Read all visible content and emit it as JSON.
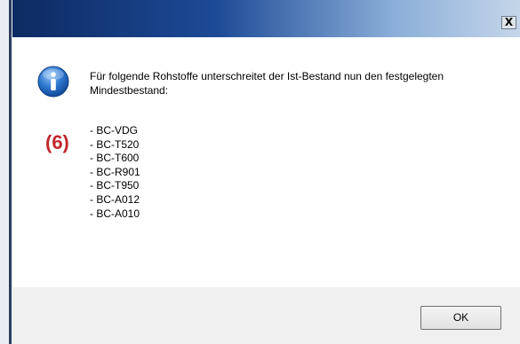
{
  "titlebar": {
    "close_label": "X"
  },
  "message": {
    "text": "Für folgende Rohstoffe unterschreitet der Ist-Bestand nun den festgelegten Mindestbestand:"
  },
  "items": [
    "- BC-VDG",
    "- BC-T520",
    "- BC-T600",
    "- BC-R901",
    "- BC-T950",
    "- BC-A012",
    "- BC-A010"
  ],
  "annotation": "(6)",
  "footer": {
    "ok_label": "OK"
  },
  "icon": "info-icon",
  "colors": {
    "annotation": "#c1272d",
    "titlebar_start": "#0d2a62",
    "titlebar_end": "#c5d6ea"
  }
}
